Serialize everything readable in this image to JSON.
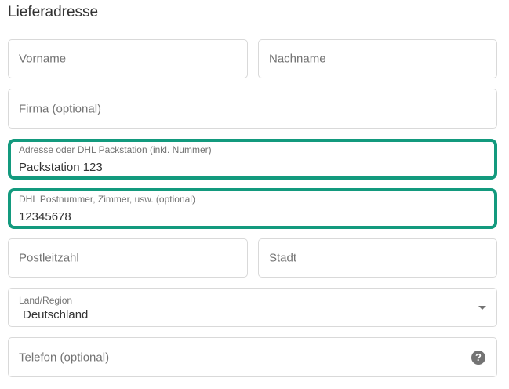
{
  "section": {
    "title": "Lieferadresse"
  },
  "fields": {
    "first_name": {
      "placeholder": "Vorname"
    },
    "last_name": {
      "placeholder": "Nachname"
    },
    "company": {
      "placeholder": "Firma (optional)"
    },
    "address": {
      "label": "Adresse oder DHL Packstation (inkl. Nummer)",
      "value": "Packstation 123"
    },
    "address2": {
      "label": "DHL Postnummer, Zimmer, usw. (optional)",
      "value": "12345678"
    },
    "postal_code": {
      "placeholder": "Postleitzahl"
    },
    "city": {
      "placeholder": "Stadt"
    },
    "country": {
      "label": "Land/Region",
      "value": "Deutschland"
    },
    "phone": {
      "placeholder": "Telefon (optional)",
      "help_icon": "?"
    }
  },
  "colors": {
    "focus_border": "#139a7e",
    "field_border": "#d9d9d9",
    "placeholder_text": "#737373",
    "value_text": "#333333"
  },
  "icons": {
    "country_dropdown": "chevron-down-icon",
    "phone_help": "question-circle-icon"
  }
}
